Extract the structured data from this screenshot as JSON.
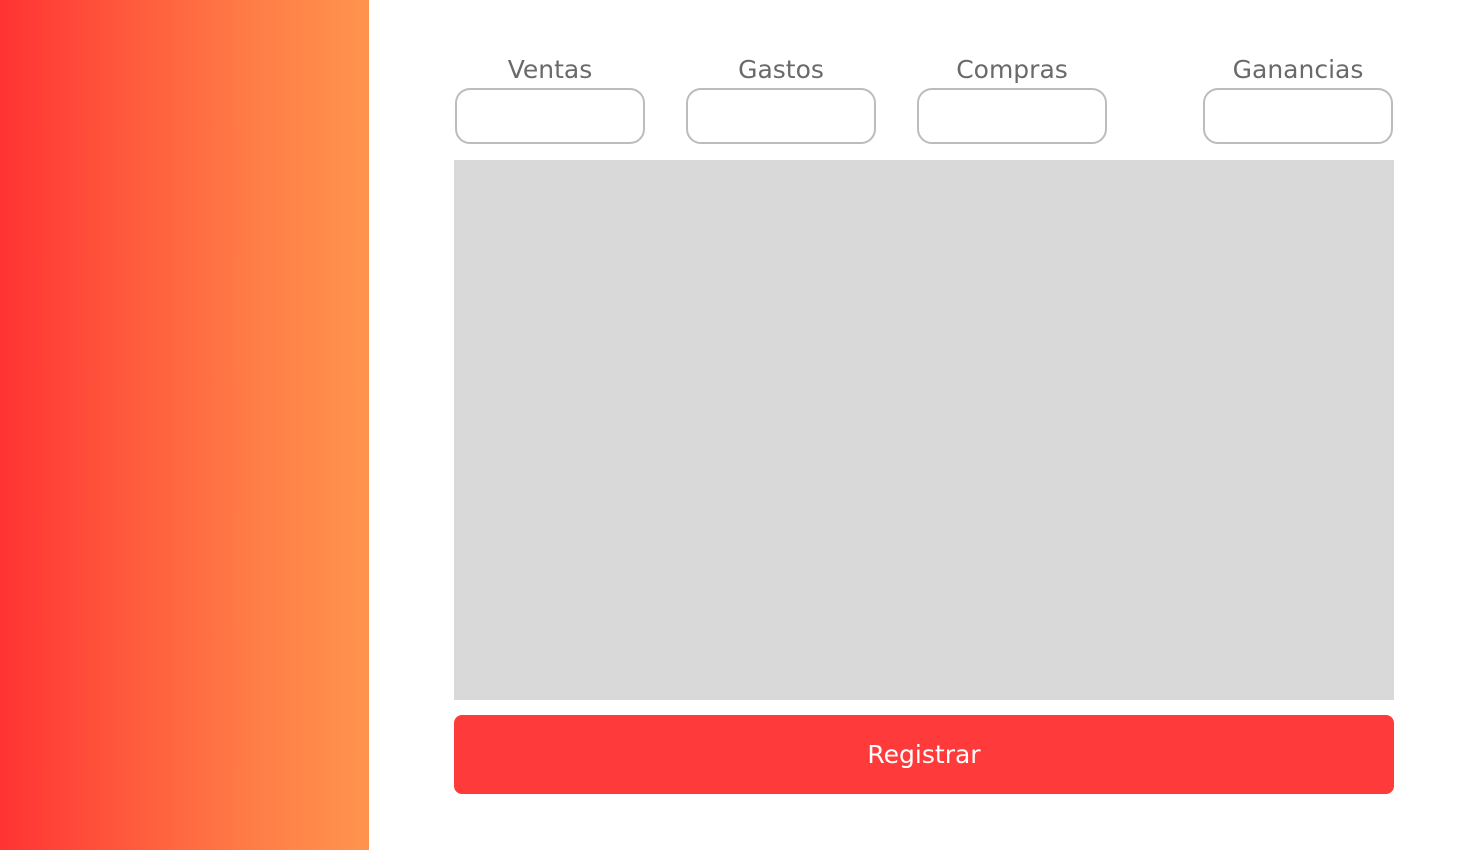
{
  "colors": {
    "sidebar_gradient_start": "#ff3333",
    "sidebar_gradient_end": "#ff944d",
    "label_text": "#6a6a6a",
    "input_border": "#bcbcbc",
    "panel_background": "#d9d9d9",
    "button_background": "#ff3a3a",
    "button_text": "#ffffff"
  },
  "metrics": [
    {
      "label": "Ventas",
      "value": ""
    },
    {
      "label": "Gastos",
      "value": ""
    },
    {
      "label": "Compras",
      "value": ""
    },
    {
      "label": "Ganancias",
      "value": ""
    }
  ],
  "actions": {
    "register_label": "Registrar"
  }
}
